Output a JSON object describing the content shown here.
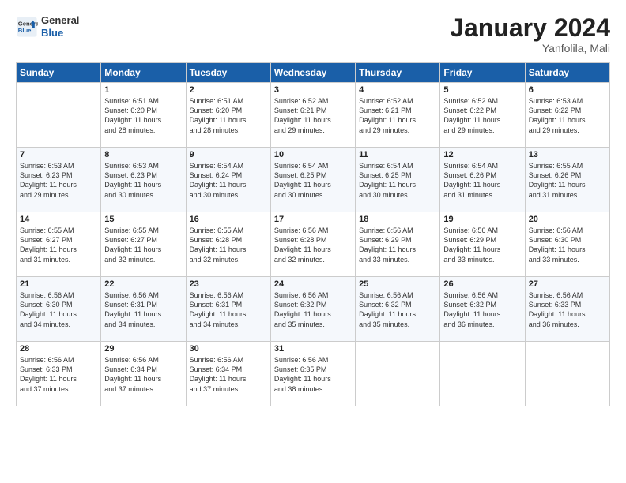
{
  "logo": {
    "line1": "General",
    "line2": "Blue"
  },
  "title": "January 2024",
  "location": "Yanfolila, Mali",
  "days_header": [
    "Sunday",
    "Monday",
    "Tuesday",
    "Wednesday",
    "Thursday",
    "Friday",
    "Saturday"
  ],
  "weeks": [
    [
      {
        "day": "",
        "info": ""
      },
      {
        "day": "1",
        "info": "Sunrise: 6:51 AM\nSunset: 6:20 PM\nDaylight: 11 hours\nand 28 minutes."
      },
      {
        "day": "2",
        "info": "Sunrise: 6:51 AM\nSunset: 6:20 PM\nDaylight: 11 hours\nand 28 minutes."
      },
      {
        "day": "3",
        "info": "Sunrise: 6:52 AM\nSunset: 6:21 PM\nDaylight: 11 hours\nand 29 minutes."
      },
      {
        "day": "4",
        "info": "Sunrise: 6:52 AM\nSunset: 6:21 PM\nDaylight: 11 hours\nand 29 minutes."
      },
      {
        "day": "5",
        "info": "Sunrise: 6:52 AM\nSunset: 6:22 PM\nDaylight: 11 hours\nand 29 minutes."
      },
      {
        "day": "6",
        "info": "Sunrise: 6:53 AM\nSunset: 6:22 PM\nDaylight: 11 hours\nand 29 minutes."
      }
    ],
    [
      {
        "day": "7",
        "info": "Sunrise: 6:53 AM\nSunset: 6:23 PM\nDaylight: 11 hours\nand 29 minutes."
      },
      {
        "day": "8",
        "info": "Sunrise: 6:53 AM\nSunset: 6:23 PM\nDaylight: 11 hours\nand 30 minutes."
      },
      {
        "day": "9",
        "info": "Sunrise: 6:54 AM\nSunset: 6:24 PM\nDaylight: 11 hours\nand 30 minutes."
      },
      {
        "day": "10",
        "info": "Sunrise: 6:54 AM\nSunset: 6:25 PM\nDaylight: 11 hours\nand 30 minutes."
      },
      {
        "day": "11",
        "info": "Sunrise: 6:54 AM\nSunset: 6:25 PM\nDaylight: 11 hours\nand 30 minutes."
      },
      {
        "day": "12",
        "info": "Sunrise: 6:54 AM\nSunset: 6:26 PM\nDaylight: 11 hours\nand 31 minutes."
      },
      {
        "day": "13",
        "info": "Sunrise: 6:55 AM\nSunset: 6:26 PM\nDaylight: 11 hours\nand 31 minutes."
      }
    ],
    [
      {
        "day": "14",
        "info": "Sunrise: 6:55 AM\nSunset: 6:27 PM\nDaylight: 11 hours\nand 31 minutes."
      },
      {
        "day": "15",
        "info": "Sunrise: 6:55 AM\nSunset: 6:27 PM\nDaylight: 11 hours\nand 32 minutes."
      },
      {
        "day": "16",
        "info": "Sunrise: 6:55 AM\nSunset: 6:28 PM\nDaylight: 11 hours\nand 32 minutes."
      },
      {
        "day": "17",
        "info": "Sunrise: 6:56 AM\nSunset: 6:28 PM\nDaylight: 11 hours\nand 32 minutes."
      },
      {
        "day": "18",
        "info": "Sunrise: 6:56 AM\nSunset: 6:29 PM\nDaylight: 11 hours\nand 33 minutes."
      },
      {
        "day": "19",
        "info": "Sunrise: 6:56 AM\nSunset: 6:29 PM\nDaylight: 11 hours\nand 33 minutes."
      },
      {
        "day": "20",
        "info": "Sunrise: 6:56 AM\nSunset: 6:30 PM\nDaylight: 11 hours\nand 33 minutes."
      }
    ],
    [
      {
        "day": "21",
        "info": "Sunrise: 6:56 AM\nSunset: 6:30 PM\nDaylight: 11 hours\nand 34 minutes."
      },
      {
        "day": "22",
        "info": "Sunrise: 6:56 AM\nSunset: 6:31 PM\nDaylight: 11 hours\nand 34 minutes."
      },
      {
        "day": "23",
        "info": "Sunrise: 6:56 AM\nSunset: 6:31 PM\nDaylight: 11 hours\nand 34 minutes."
      },
      {
        "day": "24",
        "info": "Sunrise: 6:56 AM\nSunset: 6:32 PM\nDaylight: 11 hours\nand 35 minutes."
      },
      {
        "day": "25",
        "info": "Sunrise: 6:56 AM\nSunset: 6:32 PM\nDaylight: 11 hours\nand 35 minutes."
      },
      {
        "day": "26",
        "info": "Sunrise: 6:56 AM\nSunset: 6:32 PM\nDaylight: 11 hours\nand 36 minutes."
      },
      {
        "day": "27",
        "info": "Sunrise: 6:56 AM\nSunset: 6:33 PM\nDaylight: 11 hours\nand 36 minutes."
      }
    ],
    [
      {
        "day": "28",
        "info": "Sunrise: 6:56 AM\nSunset: 6:33 PM\nDaylight: 11 hours\nand 37 minutes."
      },
      {
        "day": "29",
        "info": "Sunrise: 6:56 AM\nSunset: 6:34 PM\nDaylight: 11 hours\nand 37 minutes."
      },
      {
        "day": "30",
        "info": "Sunrise: 6:56 AM\nSunset: 6:34 PM\nDaylight: 11 hours\nand 37 minutes."
      },
      {
        "day": "31",
        "info": "Sunrise: 6:56 AM\nSunset: 6:35 PM\nDaylight: 11 hours\nand 38 minutes."
      },
      {
        "day": "",
        "info": ""
      },
      {
        "day": "",
        "info": ""
      },
      {
        "day": "",
        "info": ""
      }
    ]
  ]
}
